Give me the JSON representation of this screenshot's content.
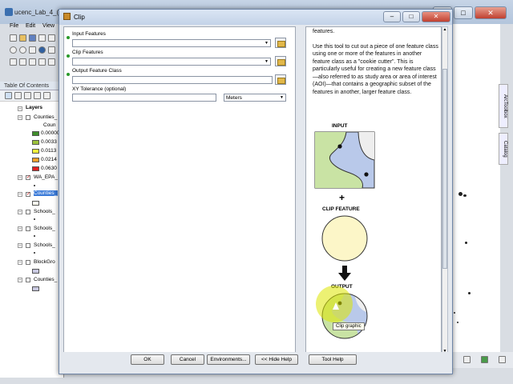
{
  "app": {
    "title": "ucenc_Lab_4_(te"
  },
  "menu": [
    "File",
    "Edit",
    "View"
  ],
  "toc": {
    "header": "Table Of Contents",
    "root": "Layers",
    "layers": [
      {
        "name": "Counties_"
      },
      {
        "name": "WA_EPA_"
      },
      {
        "name": "Counties_"
      },
      {
        "name": "Schools_"
      },
      {
        "name": "Schools_"
      },
      {
        "name": "Schools_"
      },
      {
        "name": "BlockGro"
      },
      {
        "name": "Counties_"
      }
    ],
    "legend_field": "Coun",
    "legend": [
      {
        "label": "0.00000",
        "color": "#3f8f2c"
      },
      {
        "label": "0.0033",
        "color": "#9dc33b"
      },
      {
        "label": "0.0113",
        "color": "#f0ef3a"
      },
      {
        "label": "0.0214",
        "color": "#f0a028"
      },
      {
        "label": "0.0630",
        "color": "#e02020"
      }
    ]
  },
  "side_tabs": [
    "ArcToolbox",
    "Catalog"
  ],
  "dialog": {
    "title": "Clip",
    "fields": {
      "input_label": "Input Features",
      "clip_label": "Clip Features",
      "output_label": "Output Feature Class",
      "tolerance_label": "XY Tolerance (optional)",
      "tolerance_value": "",
      "units_value": "Meters"
    },
    "help": {
      "top_fragment": "features.",
      "paragraph": "Use this tool to cut out a piece of one feature class using one or more of the features in another feature class as a \"cookie cutter\". This is particularly useful for creating a new feature class—also referred to as study area or area of interest (AOI)—that contains a geographic subset of the features in another, larger feature class.",
      "input_caption": "INPUT",
      "plus": "+",
      "clip_caption": "CLIP FEATURE",
      "arrow": "➜",
      "output_caption": "OUTPUT",
      "tooltip": "Clip graphic"
    },
    "buttons": {
      "ok": "OK",
      "cancel": "Cancel",
      "environments": "Environments...",
      "hide_help": "<< Hide Help",
      "tool_help": "Tool Help"
    }
  },
  "colors": {
    "accent": "#c3d3e8",
    "required_dot": "#2a9a2a",
    "clip_fill": "#fcf6c8"
  }
}
